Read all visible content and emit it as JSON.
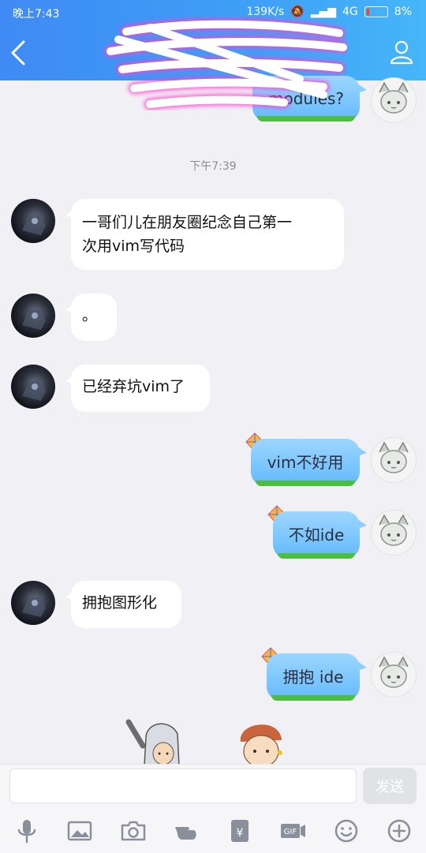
{
  "status_bar": {
    "time": "晚上7:43",
    "speed": "139K/s",
    "network": "4G",
    "battery": "8%"
  },
  "chat": {
    "partial_top_message": "modules?",
    "timestamp": "下午7:39",
    "messages": [
      {
        "side": "left",
        "text_line1": "一哥们儿在朋友圈纪念自己第一",
        "text_line2": "次用vim写代码"
      },
      {
        "side": "left",
        "text": "。"
      },
      {
        "side": "left",
        "text": "已经弃坑vim了"
      },
      {
        "side": "right",
        "text": "vim不好用"
      },
      {
        "side": "right",
        "text": "不如ide"
      },
      {
        "side": "left",
        "text": "拥抱图形化"
      },
      {
        "side": "right",
        "text": "拥抱 ide"
      }
    ]
  },
  "input": {
    "placeholder": "",
    "send_label": "发送"
  },
  "toolbar": {
    "icons": [
      "microphone-icon",
      "image-icon",
      "camera-icon",
      "poke-hand-icon",
      "red-packet-icon",
      "gif-icon",
      "emoji-icon",
      "plus-icon"
    ]
  },
  "colors": {
    "header_start": "#3f8af4",
    "header_end": "#46b6f8",
    "bubble_blue": "#74c2ff",
    "grass_green": "#4cbd3f"
  }
}
